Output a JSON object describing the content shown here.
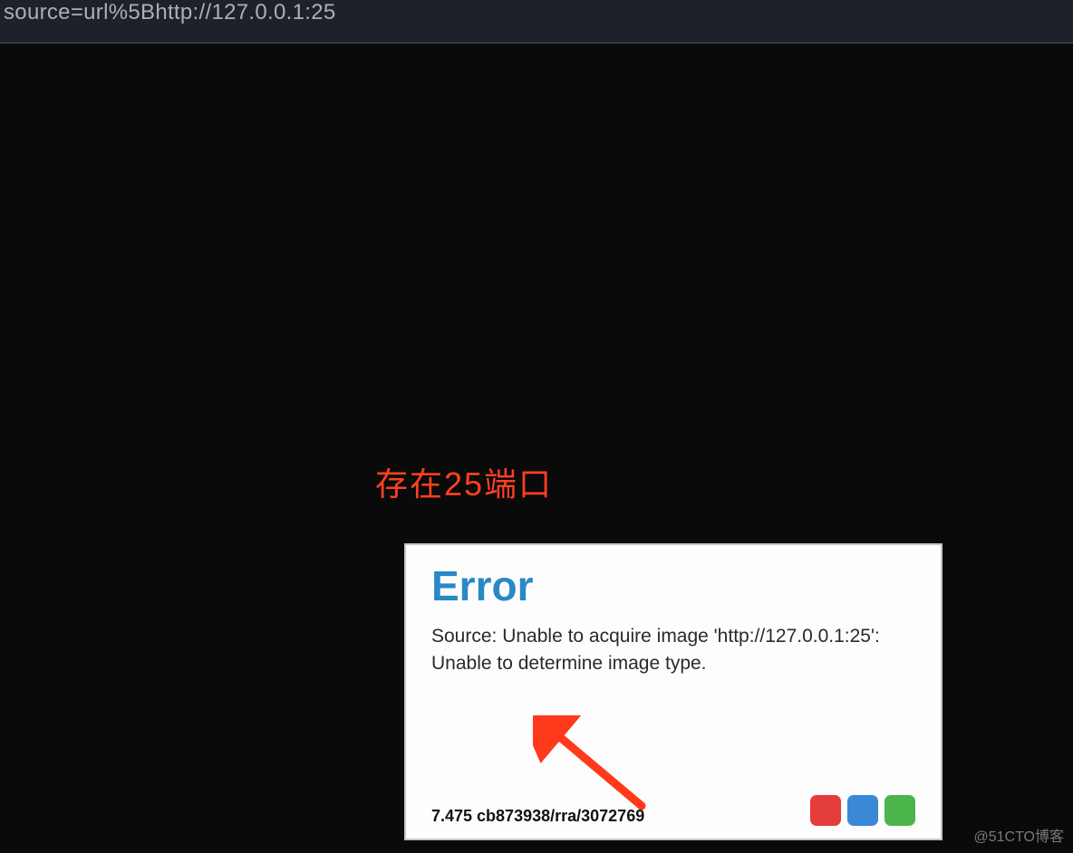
{
  "url_bar": {
    "text": "source=url%5Bhttp://127.0.0.1:25"
  },
  "annotation": {
    "label": "存在25端口",
    "color": "#ff4020"
  },
  "error_box": {
    "title": "Error",
    "message": "Source: Unable to acquire image 'http://127.0.0.1:25': Unable to determine image type.",
    "version": "7.475 cb873938/rra/3072769",
    "squares": [
      {
        "name": "red",
        "color": "#e53c3c"
      },
      {
        "name": "blue",
        "color": "#3b88d6"
      },
      {
        "name": "green",
        "color": "#4bb54b"
      }
    ]
  },
  "watermark": {
    "text": "@51CTO博客"
  }
}
